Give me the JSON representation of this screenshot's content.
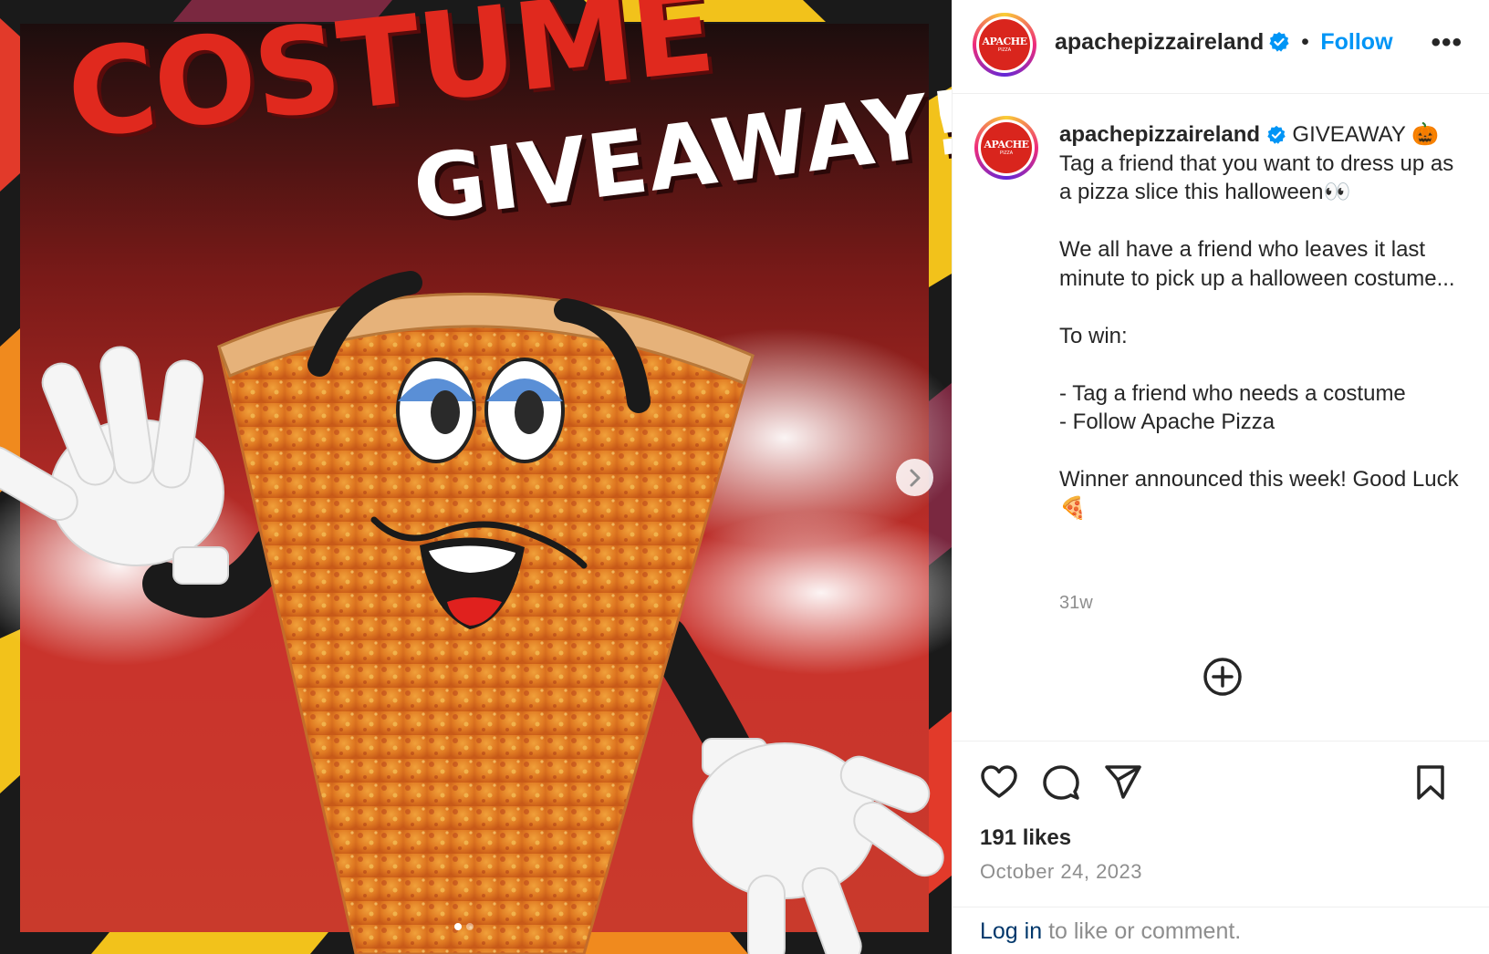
{
  "post": {
    "image": {
      "headline_line1": "COSTUME",
      "headline_line2": "GIVEAWAY!",
      "next_icon": "chevron-right",
      "carousel_dots": 2,
      "carousel_active": 1
    },
    "header": {
      "avatar_logo_text": "APACHE",
      "avatar_logo_subtext": "PIZZA",
      "username": "apachepizzaireland",
      "separator": "•",
      "follow_label": "Follow",
      "more_label": "•••"
    },
    "caption": {
      "username": "apachepizzaireland",
      "lines": [
        "GIVEAWAY 🎃 Tag a friend that you want to dress up as a pizza slice this halloween👀",
        "",
        "We all have a friend who leaves it last minute to pick up a halloween costume...",
        "",
        "To win:",
        "",
        "- Tag a friend who needs a costume",
        "- Follow Apache Pizza",
        "",
        "Winner announced this week! Good Luck🍕"
      ],
      "time": "31w"
    },
    "likes": "191 likes",
    "date": "October 24, 2023",
    "login": {
      "link": "Log in",
      "text": " to like or comment."
    }
  },
  "colors": {
    "follow_blue": "#0095f6",
    "verified_blue": "#0095f6",
    "brand_red": "#d9251d",
    "headline_red": "#e0291e"
  },
  "icons": [
    "verified-badge-icon",
    "more-icon",
    "add-comment-icon",
    "heart-icon",
    "comment-icon",
    "share-icon",
    "bookmark-icon",
    "chevron-right-icon"
  ]
}
